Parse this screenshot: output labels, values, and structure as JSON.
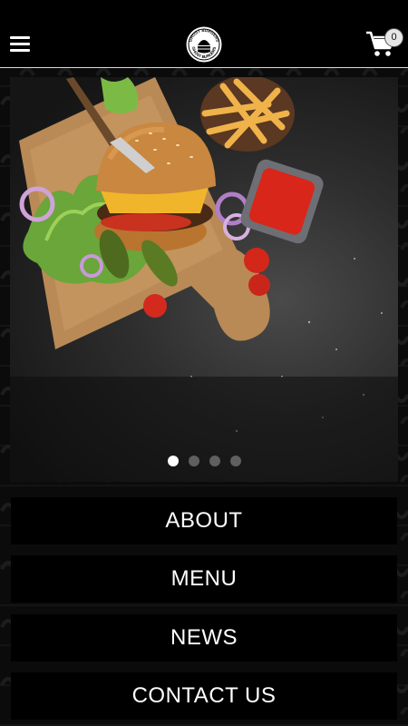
{
  "header": {
    "logo_text": "GHOST BURGERS",
    "cart_count": "0"
  },
  "carousel": {
    "slide_count": 4,
    "active_index": 0
  },
  "nav": {
    "about": "ABOUT",
    "menu": "MENU",
    "news": "NEWS",
    "contact": "CONTACT US"
  }
}
